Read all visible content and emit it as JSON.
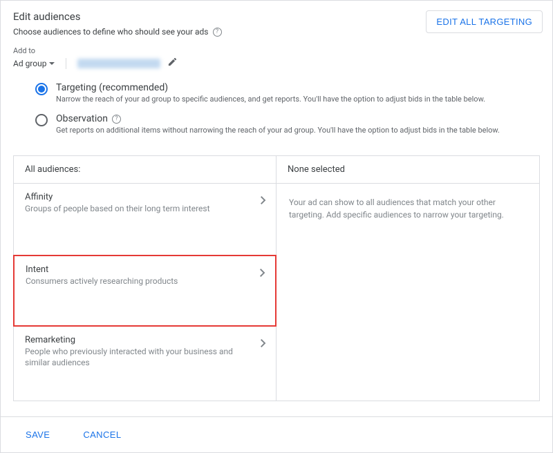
{
  "header": {
    "title": "Edit audiences",
    "subtitle": "Choose audiences to define who should see your ads",
    "edit_all_button": "EDIT ALL TARGETING"
  },
  "add_to": {
    "label": "Add to",
    "value": "Ad group"
  },
  "options": {
    "targeting": {
      "title": "Targeting (recommended)",
      "desc": "Narrow the reach of your ad group to specific audiences, and get reports. You'll have the option to adjust bids in the table below."
    },
    "observation": {
      "title": "Observation",
      "desc": "Get reports on additional items without narrowing the reach of your ad group. You'll have the option to adjust bids in the table below."
    }
  },
  "panels": {
    "left_header": "All audiences:",
    "right_header": "None selected",
    "right_empty": "Your ad can show to all audiences that match your other targeting. Add specific audiences to narrow your targeting.",
    "categories": {
      "affinity": {
        "title": "Affinity",
        "desc": "Groups of people based on their long term interest"
      },
      "intent": {
        "title": "Intent",
        "desc": "Consumers actively researching products"
      },
      "remarketing": {
        "title": "Remarketing",
        "desc": "People who previously interacted with your business and similar audiences"
      }
    }
  },
  "footer": {
    "save": "SAVE",
    "cancel": "CANCEL"
  }
}
